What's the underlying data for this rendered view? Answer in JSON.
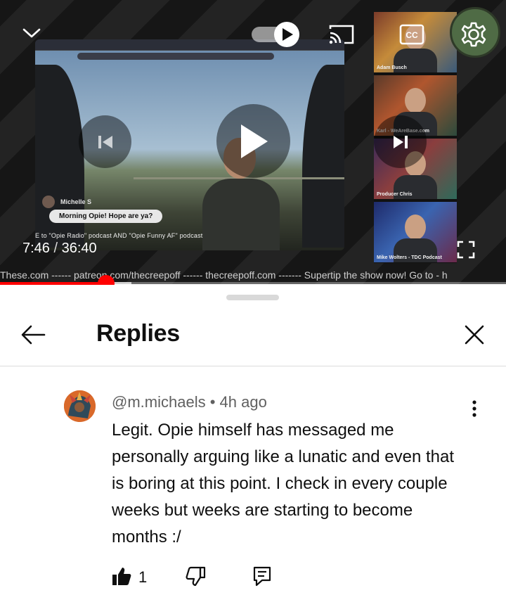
{
  "player": {
    "current_time": "7:46",
    "separator": "/",
    "duration": "36:40",
    "progress_fraction": 0.21,
    "buffer_fraction": 0.26,
    "marquee_text": "These.com ------ patreon.com/thecreepoff ------ thecreepoff.com ------- Supertip the show now! Go to - h",
    "overlay_chat_name": "Michelle S",
    "overlay_chat_message": "Morning Opie! Hope are ya?",
    "overlay_caption": "E to \"Opie Radio\" podcast AND \"Opie Funny AF\" podcast",
    "webcams": [
      {
        "label": "Adam Busch"
      },
      {
        "label": "Karl - WeAreBase.com"
      },
      {
        "label": "Producer Chris"
      },
      {
        "label": "Mike Wolters - TDC Podcast"
      }
    ],
    "icons": {
      "collapse": "chevron-down-icon",
      "autoplay": "autoplay-toggle-icon",
      "cast": "cast-icon",
      "captions": "cc-icon",
      "settings": "gear-icon",
      "previous": "skip-previous-icon",
      "play": "play-icon",
      "next": "skip-next-icon",
      "fullscreen": "fullscreen-icon"
    },
    "accent_color": "#ff0000"
  },
  "sheet": {
    "title": "Replies",
    "icons": {
      "back": "arrow-left-icon",
      "close": "close-icon"
    }
  },
  "reply": {
    "author": "@m.michaels",
    "separator": "•",
    "time": "4h ago",
    "text": "Legit. Opie himself has messaged me personally arguing like a lunatic and even that is boring at this point. I check in every couple weeks but weeks are starting to become months :/",
    "like_count": "1",
    "icons": {
      "like": "thumbs-up-filled-icon",
      "dislike": "thumbs-down-icon",
      "reply": "comment-icon",
      "more": "more-vertical-icon"
    }
  }
}
